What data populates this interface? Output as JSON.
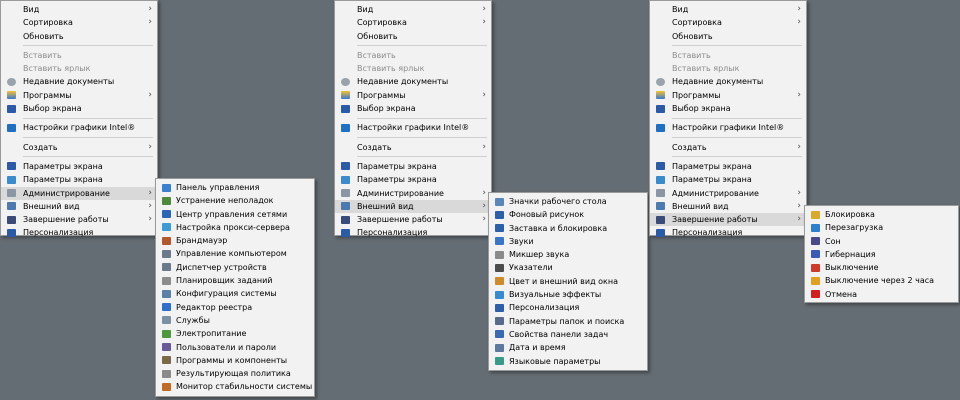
{
  "menu_labels": {
    "view": "Вид",
    "sort": "Сортировка",
    "refresh": "Обновить",
    "paste": "Вставить",
    "paste_shortcut": "Вставить ярлык",
    "recent_docs": "Недавние документы",
    "programs": "Программы",
    "screen_select": "Выбор экрана",
    "intel_graphics": "Настройки графики Intel®",
    "create": "Создать",
    "screen_params": "Параметры экрана",
    "admin": "Администрирование",
    "appearance": "Внешний вид",
    "shutdown": "Завершение работы",
    "personalization": "Персонализация"
  },
  "submenus": {
    "admin": {
      "items": [
        {
          "label": "Панель управления",
          "icon": "control-panel-icon",
          "color": "#3b7fd1"
        },
        {
          "label": "Устранение неполадок",
          "icon": "troubleshoot-icon",
          "color": "#4f8a3a"
        },
        {
          "label": "Центр управления сетями",
          "icon": "network-icon",
          "color": "#2c66b8"
        },
        {
          "label": "Настройка прокси-сервера",
          "icon": "proxy-icon",
          "color": "#3c9ad6"
        },
        {
          "label": "Брандмауэр",
          "icon": "firewall-icon",
          "color": "#b5572c"
        },
        {
          "label": "Управление компьютером",
          "icon": "computer-management-icon",
          "color": "#6b7a8a"
        },
        {
          "label": "Диспетчер устройств",
          "icon": "device-manager-icon",
          "color": "#6b7a8a"
        },
        {
          "label": "Планировщик заданий",
          "icon": "task-scheduler-icon",
          "color": "#8c8c8c"
        },
        {
          "label": "Конфигурация системы",
          "icon": "system-config-icon",
          "color": "#5a7fa8"
        },
        {
          "label": "Редактор реестра",
          "icon": "registry-icon",
          "color": "#2f6fc9"
        },
        {
          "label": "Службы",
          "icon": "services-icon",
          "color": "#7d8fa3"
        },
        {
          "label": "Электропитание",
          "icon": "power-options-icon",
          "color": "#4d9a3e"
        },
        {
          "label": "Пользователи и пароли",
          "icon": "users-icon",
          "color": "#6b5a9a"
        },
        {
          "label": "Программы и компоненты",
          "icon": "programs-features-icon",
          "color": "#7a6a4a"
        },
        {
          "label": "Результирующая политика",
          "icon": "policy-icon",
          "color": "#8a8a8a"
        },
        {
          "label": "Монитор стабильности системы",
          "icon": "stability-monitor-icon",
          "color": "#c06a2a"
        }
      ]
    },
    "appearance": {
      "items": [
        {
          "label": "Значки рабочего стола",
          "icon": "desktop-icons-icon",
          "color": "#5a86b8"
        },
        {
          "label": "Фоновый рисунок",
          "icon": "wallpaper-icon",
          "color": "#2d5fa8"
        },
        {
          "label": "Заставка и блокировка",
          "icon": "screensaver-icon",
          "color": "#2d5fa8"
        },
        {
          "label": "Звуки",
          "icon": "sounds-icon",
          "color": "#3a76c8"
        },
        {
          "label": "Микшер звука",
          "icon": "mixer-icon",
          "color": "#8a8a8a"
        },
        {
          "label": "Указатели",
          "icon": "pointers-icon",
          "color": "#4d4d4d"
        },
        {
          "label": "Цвет и внешний вид окна",
          "icon": "window-color-icon",
          "color": "#d08a2a"
        },
        {
          "label": "Визуальные эффекты",
          "icon": "visual-effects-icon",
          "color": "#3a8ad0"
        },
        {
          "label": "Персонализация",
          "icon": "personalization-icon",
          "color": "#2d5fa8"
        },
        {
          "label": "Параметры папок и поиска",
          "icon": "folder-options-icon",
          "color": "#5a6a8a"
        },
        {
          "label": "Свойства панели задач",
          "icon": "taskbar-icon",
          "color": "#3a6ab0"
        },
        {
          "label": "Дата и время",
          "icon": "datetime-icon",
          "color": "#5a7aa0"
        },
        {
          "label": "Языковые параметры",
          "icon": "language-icon",
          "color": "#3a9a8a"
        }
      ]
    },
    "shutdown": {
      "items": [
        {
          "label": "Блокировка",
          "icon": "lock-icon",
          "color": "#d9a92a"
        },
        {
          "label": "Перезагрузка",
          "icon": "restart-icon",
          "color": "#2f7fd0"
        },
        {
          "label": "Сон",
          "icon": "sleep-icon",
          "color": "#4a4a8a"
        },
        {
          "label": "Гибернация",
          "icon": "hibernate-icon",
          "color": "#3a5ab8"
        },
        {
          "label": "Выключение",
          "icon": "power-off-icon",
          "color": "#d03a2a"
        },
        {
          "label": "Выключение через 2 часа",
          "icon": "timer-shutdown-icon",
          "color": "#e0a020"
        },
        {
          "label": "Отмена",
          "icon": "cancel-icon",
          "color": "#d02020"
        }
      ]
    }
  },
  "colors": {
    "desktop_bg": "#646d73",
    "menu_bg": "#f2f2f2",
    "highlight": "#d9d9d9"
  }
}
